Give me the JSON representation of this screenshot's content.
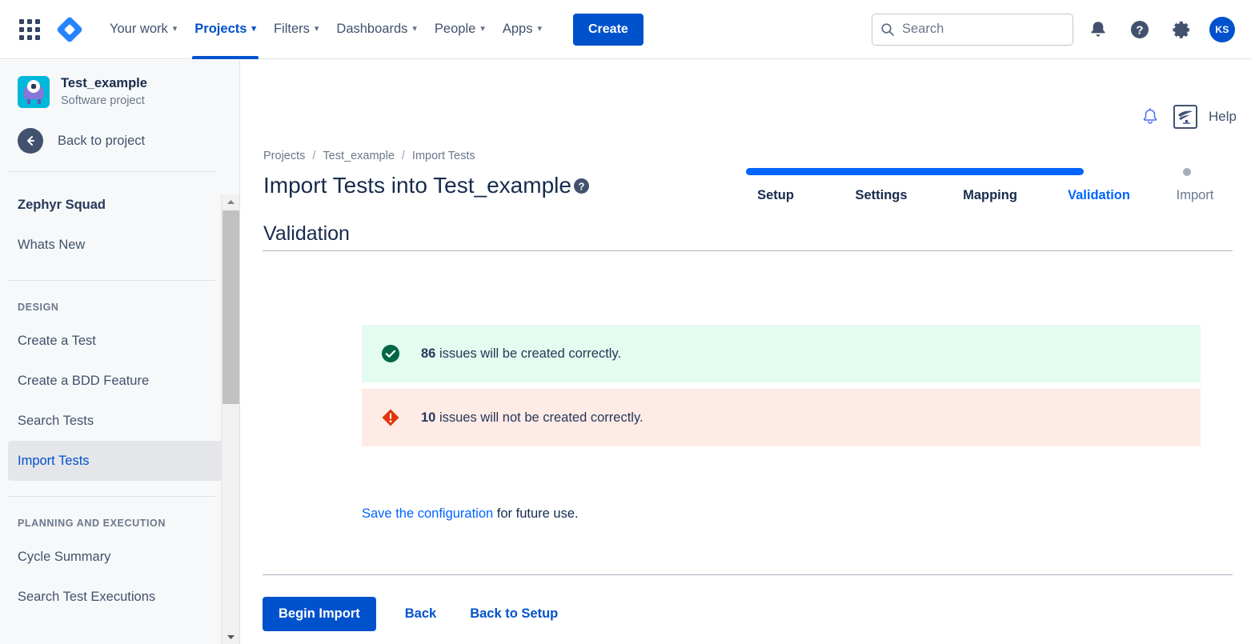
{
  "topnav": {
    "app_switcher_icon": "grid-apps-icon",
    "logo_icon": "jira-logo-icon",
    "items": [
      {
        "label": "Your work",
        "has_chevron": true,
        "active": false
      },
      {
        "label": "Projects",
        "has_chevron": true,
        "active": true
      },
      {
        "label": "Filters",
        "has_chevron": true,
        "active": false
      },
      {
        "label": "Dashboards",
        "has_chevron": true,
        "active": false
      },
      {
        "label": "People",
        "has_chevron": true,
        "active": false
      },
      {
        "label": "Apps",
        "has_chevron": true,
        "active": false
      }
    ],
    "create_label": "Create",
    "search": {
      "placeholder": "Search",
      "value": "",
      "icon": "search-icon"
    },
    "notifications_icon": "notifications-bell-icon",
    "help_icon": "help-circle-icon",
    "settings_icon": "gear-icon",
    "avatar_initials": "KS"
  },
  "sidebar": {
    "project_name": "Test_example",
    "project_type": "Software project",
    "project_icon": "project-avatar-icon",
    "back_label": "Back to project",
    "back_icon": "arrow-left-icon",
    "app_name": "Zephyr Squad",
    "whats_new": "Whats New",
    "design_header": "DESIGN",
    "design_items": [
      {
        "label": "Create a Test",
        "selected": false
      },
      {
        "label": "Create a BDD Feature",
        "selected": false
      },
      {
        "label": "Search Tests",
        "selected": false
      },
      {
        "label": "Import Tests",
        "selected": true
      }
    ],
    "planning_header": "PLANNING AND EXECUTION",
    "planning_items": [
      {
        "label": "Cycle Summary",
        "selected": false
      },
      {
        "label": "Search Test Executions",
        "selected": false
      }
    ],
    "scrollbar": {
      "up_icon": "scroll-up-arrow-icon",
      "down_icon": "scroll-down-arrow-icon"
    }
  },
  "main": {
    "bell_icon": "bell-outline-icon",
    "zephyr_icon": "zephyr-logo-icon",
    "help_label": "Help",
    "breadcrumb": [
      {
        "label": "Projects"
      },
      {
        "label": "Test_example"
      },
      {
        "label": "Import Tests"
      }
    ],
    "breadcrumb_separator": "/",
    "title": "Import Tests into Test_example",
    "title_help_icon": "help-circle-icon",
    "section_title": "Validation",
    "stepper": {
      "steps": [
        {
          "label": "Setup",
          "state": "done"
        },
        {
          "label": "Settings",
          "state": "done"
        },
        {
          "label": "Mapping",
          "state": "done"
        },
        {
          "label": "Validation",
          "state": "current"
        },
        {
          "label": "Import",
          "state": "todo"
        }
      ],
      "progress_color": "#0065ff",
      "pending_color": "#a5adba"
    },
    "banners": [
      {
        "type": "success",
        "icon": "check-circle-icon",
        "count": "86",
        "text": " issues will be created correctly.",
        "bg": "#e3fcef",
        "icon_color": "#006644"
      },
      {
        "type": "error",
        "icon": "error-diamond-icon",
        "count": "10",
        "text": " issues will not be created correctly.",
        "bg": "#ffebe6",
        "icon_color": "#de350b"
      }
    ],
    "save_link": "Save the configuration",
    "save_suffix": " for future use.",
    "footer": {
      "primary": "Begin Import",
      "back": "Back",
      "back_to_setup": "Back to Setup"
    }
  }
}
